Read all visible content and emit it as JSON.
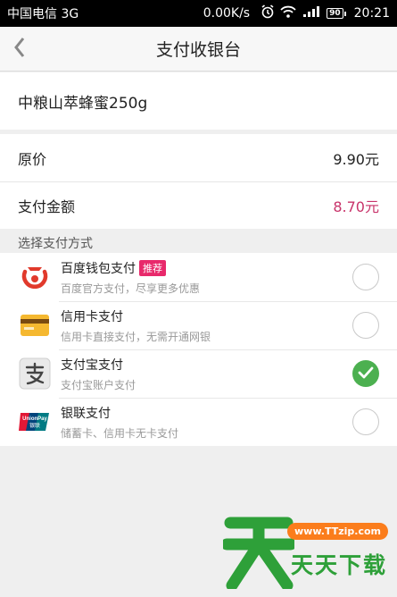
{
  "status_bar": {
    "carrier": "中国电信 3G",
    "speed": "0.00K/s",
    "battery": "90",
    "time": "20:21"
  },
  "nav": {
    "title": "支付收银台"
  },
  "product": {
    "name": "中粮山萃蜂蜜250g"
  },
  "prices": {
    "original_label": "原价",
    "original_value": "9.90元",
    "pay_label": "支付金额",
    "pay_value": "8.70元",
    "pay_color": "#c8336a"
  },
  "section_label": "选择支付方式",
  "methods": [
    {
      "name": "百度钱包支付",
      "tag": "推荐",
      "desc": "百度官方支付，尽享更多优惠",
      "icon": "baidu-wallet-icon",
      "selected": false
    },
    {
      "name": "信用卡支付",
      "desc": "信用卡直接支付，无需开通网银",
      "icon": "credit-card-icon",
      "selected": false
    },
    {
      "name": "支付宝支付",
      "desc": "支付宝账户支付",
      "icon": "alipay-icon",
      "selected": true
    },
    {
      "name": "银联支付",
      "desc": "储蓄卡、信用卡无卡支付",
      "icon": "unionpay-icon",
      "selected": false
    }
  ],
  "unionpay_logo_text": "UnionPay 银联",
  "watermark": {
    "url": "www.TTzip.com",
    "text": "天天下载",
    "logo_char": "天"
  },
  "colors": {
    "selected_green": "#4cb050",
    "tag_pink": "#e8296b",
    "watermark_green": "#2ea039"
  }
}
